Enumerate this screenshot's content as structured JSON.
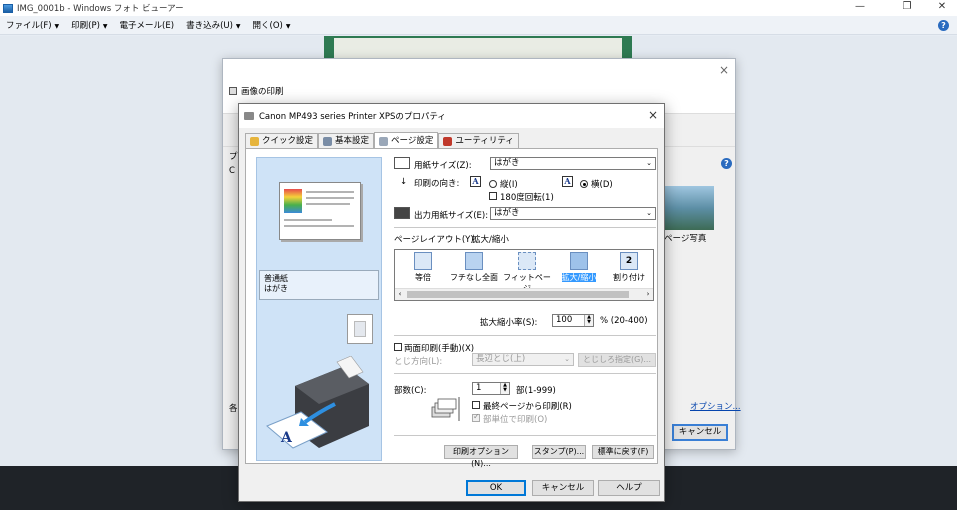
{
  "viewer": {
    "title": "IMG_0001b - Windows フォト ビューアー",
    "menu": [
      "ファイル(F)",
      "印刷(P)",
      "電子メール(E)",
      "書き込み(U)",
      "開く(O)"
    ],
    "help": "?"
  },
  "print_dialog": {
    "title": "画像の印刷",
    "close": "×",
    "help": "?",
    "thumb_label": "ページ写真",
    "options_link": "オプション...",
    "cancel": "キャンセル",
    "edge_chars": {
      "p": "プ",
      "c": "C",
      "k": "各"
    }
  },
  "props": {
    "title": "Canon MP493 series Printer XPSのプロパティ",
    "close": "×",
    "tabs": [
      "クイック設定",
      "基本設定",
      "ページ設定",
      "ユーティリティ"
    ],
    "active_tab": "ページ設定",
    "media": [
      "普通紙",
      "はがき"
    ],
    "paper_size": {
      "label": "用紙サイズ(Z):",
      "value": "はがき"
    },
    "orientation": {
      "label": "印刷の向き:",
      "portrait": "縦(I)",
      "landscape": "横(D)",
      "selected": "横(D)",
      "rotate180": "180度回転(1)",
      "glyph": "A"
    },
    "output_size": {
      "label": "出力用紙サイズ(E):",
      "value": "はがき"
    },
    "page_layout": {
      "label": "ページレイアウト(Y):",
      "value": "拡大/縮小"
    },
    "layouts": [
      "等倍",
      "フチなし全面",
      "フィットページ",
      "拡大/縮小",
      "割り付け"
    ],
    "selected_layout": "拡大/縮小",
    "layout_num": "2",
    "scale": {
      "label": "拡大縮小率(S):",
      "value": "100",
      "range": "% (20-400)"
    },
    "duplex": {
      "label": "両面印刷(手動)(X)",
      "binding_label": "とじ方向(L):",
      "binding_value": "長辺とじ(上)",
      "margin_button": "とじしろ指定(G)..."
    },
    "copies": {
      "label": "部数(C):",
      "value": "1",
      "range": "部(1-999)",
      "last_page_first": "最終ページから印刷(R)",
      "collate": "部単位で印刷(O)"
    },
    "buttons": {
      "print_options": "印刷オプション(N)...",
      "stamp": "スタンプ(P)...",
      "defaults": "標準に戻す(F)"
    },
    "footer": {
      "ok": "OK",
      "cancel": "キャンセル",
      "help": "ヘルプ"
    }
  }
}
